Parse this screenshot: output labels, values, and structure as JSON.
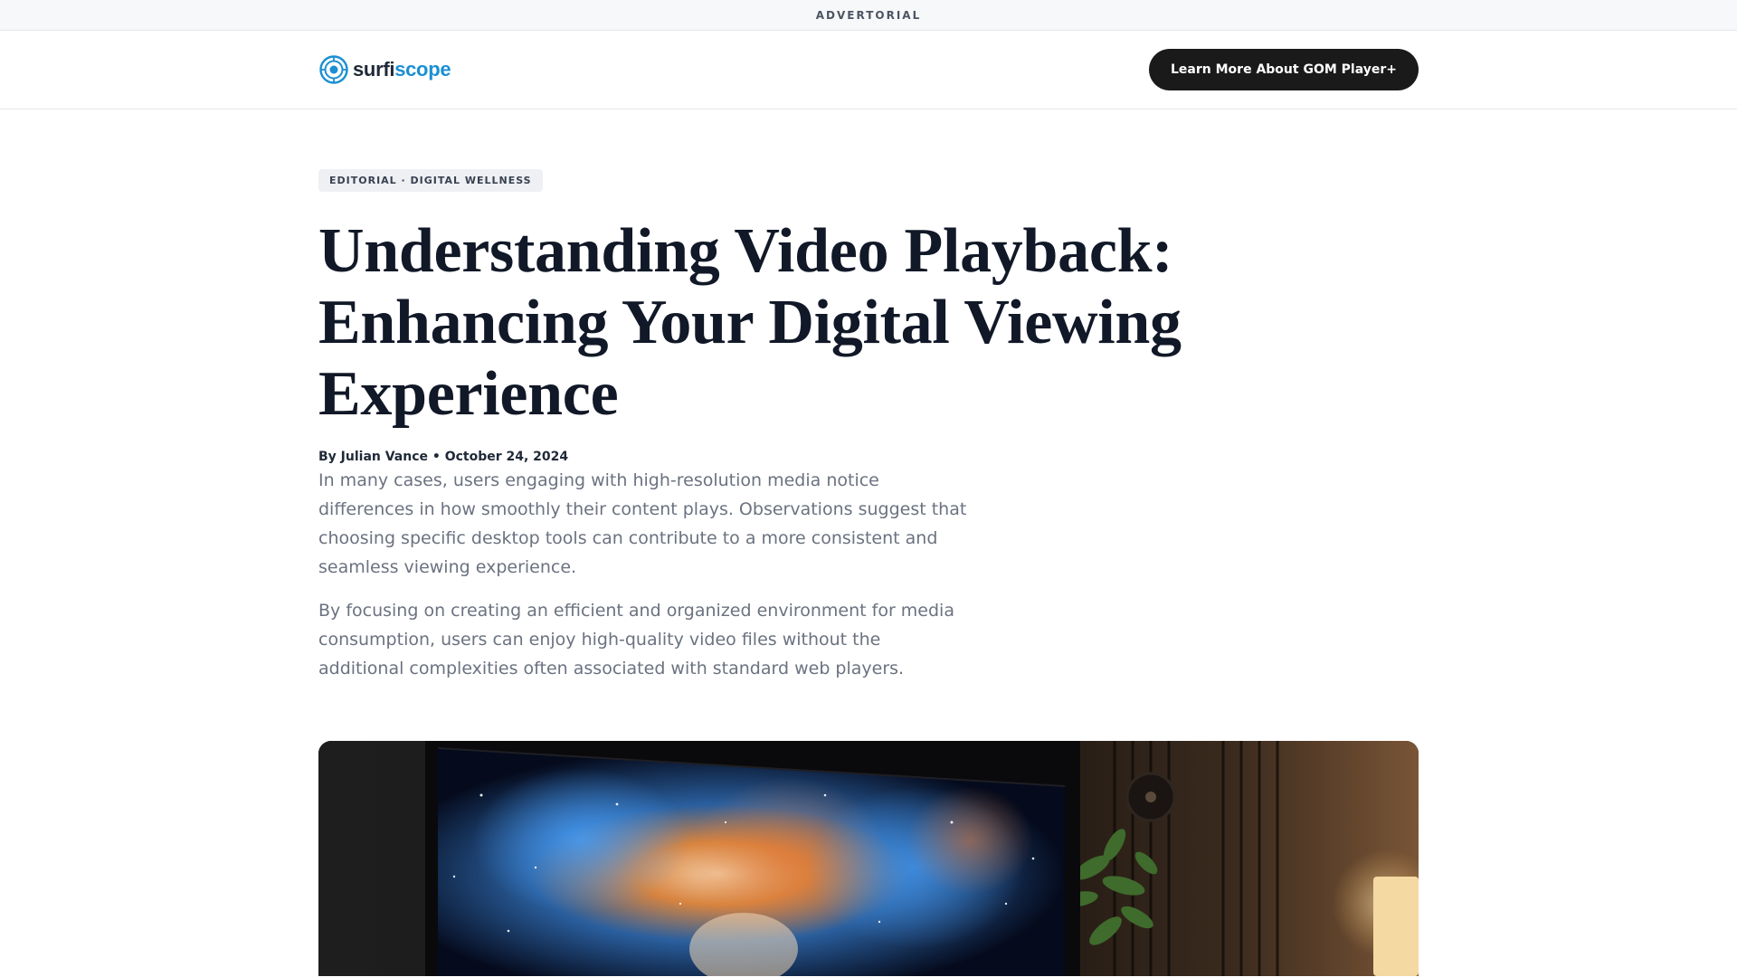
{
  "topbar": {
    "label": "ADVERTORIAL"
  },
  "header": {
    "logo": {
      "part1": "surfi",
      "part2": "scope",
      "icon": "target-globe-icon"
    },
    "cta_label": "Learn More About GOM Player+"
  },
  "article": {
    "category": "EDITORIAL · DIGITAL WELLNESS",
    "title": "Understanding Video Playback: Enhancing Your Digital Viewing Experience",
    "byline": "By Julian Vance • October 24, 2024",
    "paragraphs": [
      "In many cases, users engaging with high-resolution media notice differences in how smoothly their content plays. Observations suggest that choosing specific desktop tools can contribute to a more consistent and seamless viewing experience.",
      "By focusing on creating an efficient and organized environment for media consumption, users can enjoy high-quality video files without the additional complexities often associated with standard web players."
    ]
  },
  "colors": {
    "accent": "#1b8fd3",
    "cta_background": "#1a1a1a",
    "title": "#111827",
    "body_text": "#6b7280"
  }
}
